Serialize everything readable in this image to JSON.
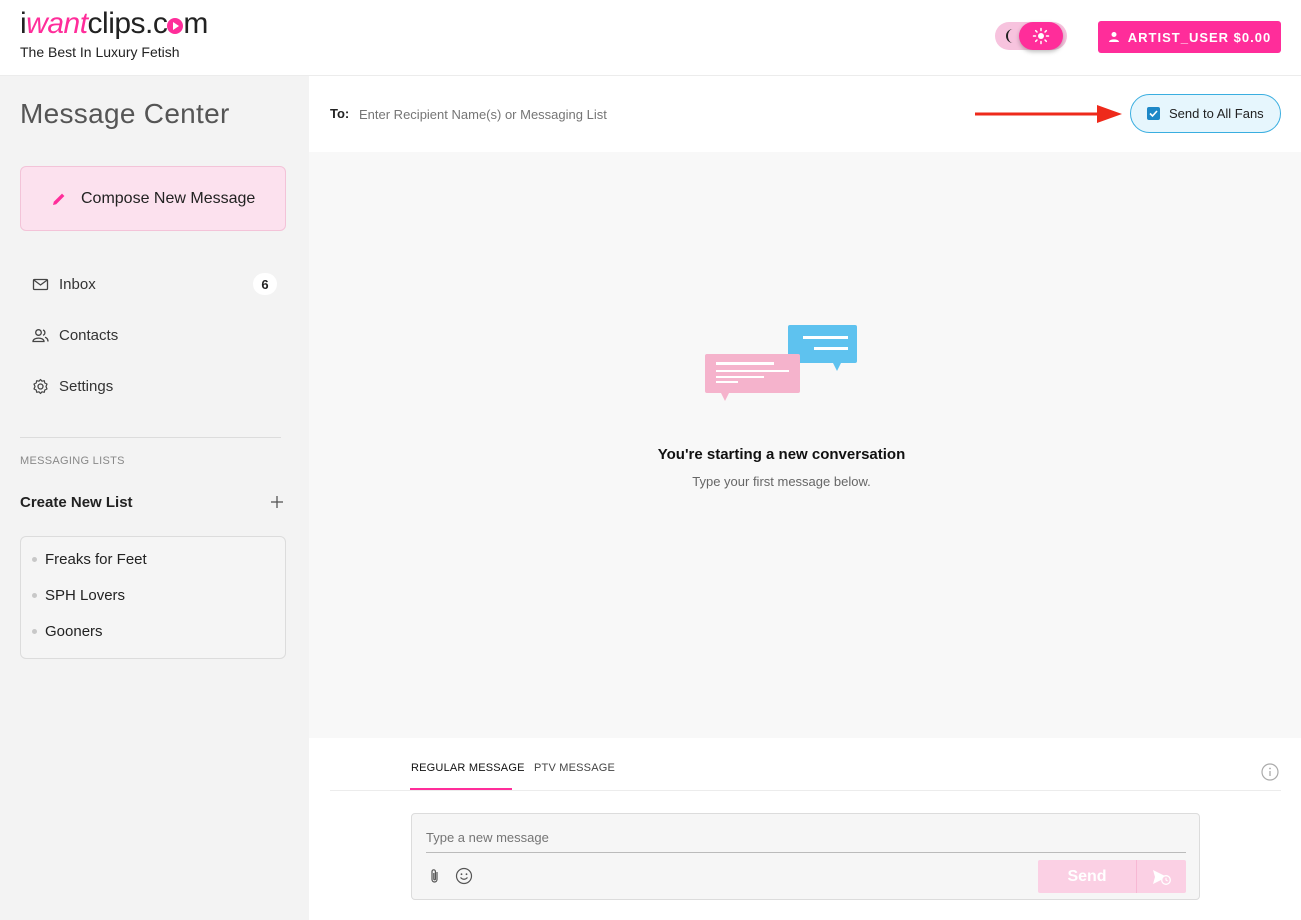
{
  "header": {
    "logo": {
      "part1": "i",
      "part2": "want",
      "part3": "clips.c",
      "part4": "m"
    },
    "tagline": "The Best In Luxury Fetish",
    "user_button_label": "ARTIST_USER $0.00"
  },
  "sidebar": {
    "title": "Message Center",
    "compose_label": "Compose New Message",
    "nav": [
      {
        "label": "Inbox",
        "badge": "6",
        "icon": "mail-icon"
      },
      {
        "label": "Contacts",
        "icon": "contacts-icon"
      },
      {
        "label": "Settings",
        "icon": "gear-icon"
      }
    ],
    "messaging_lists_heading": "MESSAGING LISTS",
    "create_list_label": "Create New List",
    "lists": [
      "Freaks for Feet",
      "SPH Lovers",
      "Gooners"
    ]
  },
  "recipient": {
    "to_label": "To:",
    "placeholder": "Enter Recipient Name(s) or Messaging List",
    "send_all_label": "Send to All Fans",
    "send_all_checked": true
  },
  "conversation": {
    "title": "You're starting a new conversation",
    "subtitle": "Type your first message below."
  },
  "composer": {
    "tabs": [
      "REGULAR MESSAGE",
      "PTV MESSAGE"
    ],
    "active_tab": "REGULAR MESSAGE",
    "placeholder": "Type a new message",
    "send_label": "Send"
  },
  "colors": {
    "brand": "#ff2d9a",
    "checkbox_blue": "#1e88c7",
    "arrow_red": "#ee2a1b",
    "bubble_pink": "#f5b3cc",
    "bubble_blue": "#5ec2ef"
  }
}
